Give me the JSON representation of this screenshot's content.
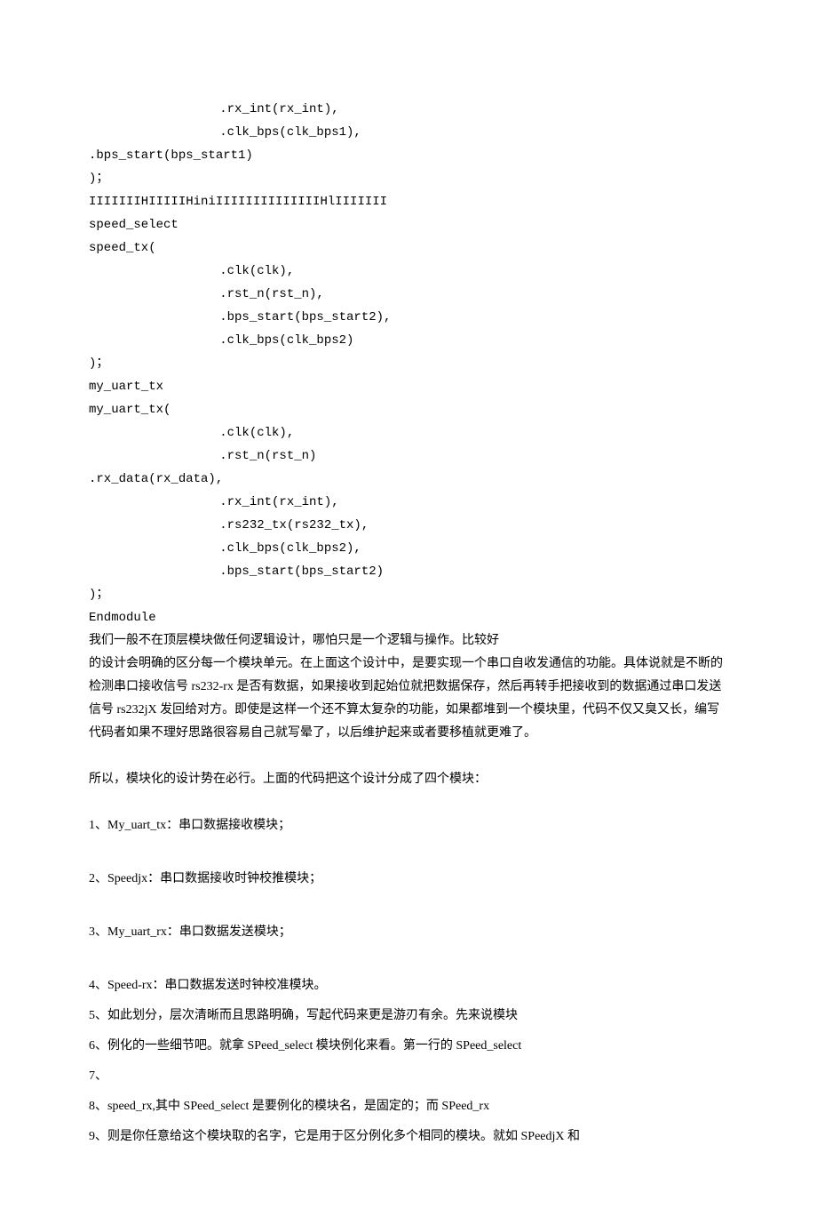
{
  "code": {
    "l1": "        .rx_int(rx_int),",
    "l2": "        .clk_bps(clk_bps1),",
    "l3": ".bps_start(bps_start1)",
    "l4": ")；",
    "l5": "IIIIIIIHIIIIIHiniIIIIIIIIIIIIIIHlIIIIIII",
    "l6": "speed_select",
    "l7": "speed_tx(",
    "l8": "        .clk(clk),",
    "l9": "        .rst_n(rst_n),",
    "l10": "        .bps_start(bps_start2),",
    "l11": "        .clk_bps(clk_bps2)",
    "l12": ")；",
    "l13": "my_uart_tx",
    "l14": "my_uart_tx(",
    "l15": "        .clk(clk),",
    "l16": "        .rst_n(rst_n)",
    "l17": ".rx_data(rx_data),",
    "l18": "        .rx_int(rx_int),",
    "l19": "        .rs232_tx(rs232_tx),",
    "l20": "        .clk_bps(clk_bps2),",
    "l21": "        .bps_start(bps_start2)",
    "l22": ")；",
    "l23": "Endmodule"
  },
  "para1": "我们一般不在顶层模块做任何逻辑设计，哪怕只是一个逻辑与操作。比较好",
  "para2": "的设计会明确的区分每一个模块单元。在上面这个设计中，是要实现一个串口自收发通信的功能。具体说就是不断的检测串口接收信号 rs232-rx 是否有数据，如果接收到起始位就把数据保存，然后再转手把接收到的数据通过串口发送信号 rs232jX 发回给对方。即使是这样一个还不算太复杂的功能，如果都堆到一个模块里，代码不仅又臭又长，编写代码者如果不理好思路很容易自己就写晕了，以后维护起来或者要移植就更难了。",
  "para3": "所以，模块化的设计势在必行。上面的代码把这个设计分成了四个模块：",
  "list": {
    "i1": "1、My_uart_tx：串口数据接收模块；",
    "i2": "2、Speedjx：串口数据接收时钟校推模块；",
    "i3": "3、My_uart_rx：串口数据发送模块；",
    "i4": "4、Speed-rx：串口数据发送时钟校准模块。",
    "i5": "5、如此划分，层次清晰而且思路明确，写起代码来更是游刃有余。先来说模块",
    "i6": "6、例化的一些细节吧。就拿 SPeed_select 模块例化来看。第一行的 SPeed_select",
    "i7": "7、",
    "i8": "8、speed_rx,其中 SPeed_select 是要例化的模块名，是固定的；而 SPeed_rx",
    "i9": "9、则是你任意给这个模块取的名字，它是用于区分例化多个相同的模块。就如 SPeedjX 和"
  }
}
